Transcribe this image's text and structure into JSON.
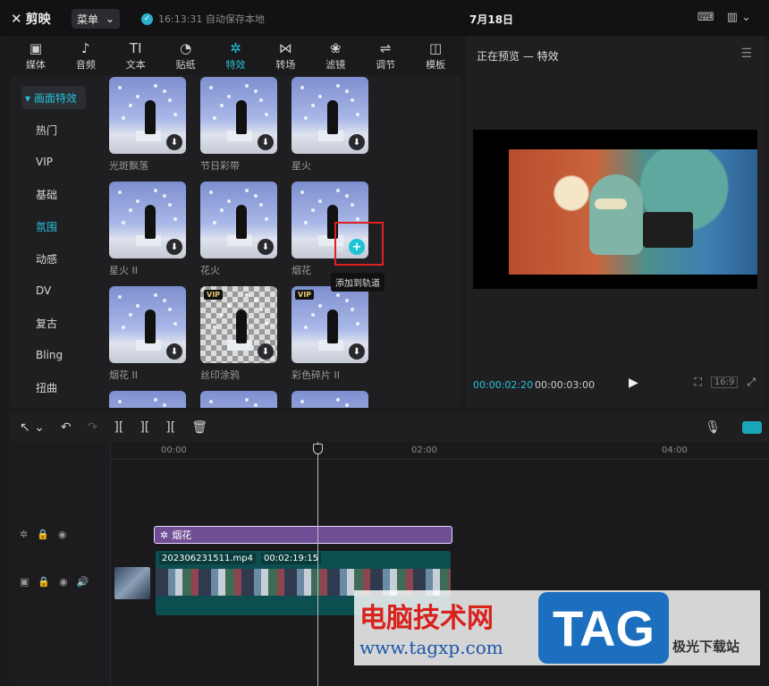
{
  "topbar": {
    "app_name": "剪映",
    "menu_label": "菜单",
    "save_status": "16:13:31 自动保存本地",
    "project_title": "7月18日"
  },
  "categories": [
    {
      "label": "媒体",
      "icon": "▣"
    },
    {
      "label": "音频",
      "icon": "♪"
    },
    {
      "label": "文本",
      "icon": "TI"
    },
    {
      "label": "贴纸",
      "icon": "◔"
    },
    {
      "label": "特效",
      "icon": "✲",
      "active": true
    },
    {
      "label": "转场",
      "icon": "⋈"
    },
    {
      "label": "滤镜",
      "icon": "❀"
    },
    {
      "label": "调节",
      "icon": "⇌"
    },
    {
      "label": "模板",
      "icon": "◫"
    }
  ],
  "subcategories": [
    {
      "label": "▾ 画面特效",
      "active": true
    },
    {
      "label": "热门"
    },
    {
      "label": "VIP"
    },
    {
      "label": "基础"
    },
    {
      "label": "氛围",
      "highlight": true
    },
    {
      "label": "动感"
    },
    {
      "label": "DV"
    },
    {
      "label": "复古"
    },
    {
      "label": "Bling"
    },
    {
      "label": "扭曲"
    }
  ],
  "effects": [
    {
      "label": "光斑飘落"
    },
    {
      "label": "节日彩带"
    },
    {
      "label": "星火"
    },
    {
      "label": "星火 II"
    },
    {
      "label": "花火"
    },
    {
      "label": "烟花",
      "hovered": true
    },
    {
      "label": "烟花 II"
    },
    {
      "label": "丝印涂鸦",
      "vip": "VIP"
    },
    {
      "label": "彩色碎片 II",
      "vip": "VIP"
    }
  ],
  "tooltip": "添加到轨道",
  "preview": {
    "title": "正在预览 — 特效",
    "time_current": "00:00:02:20",
    "time_total": "00:00:03:00",
    "ratio": "16:9"
  },
  "timeline": {
    "ticks": [
      "00:00",
      "02:00",
      "04:00"
    ],
    "effect_clip": "烟花",
    "video_clip_name": "202306231511.mp4",
    "video_clip_duration": "00:02:19:15"
  },
  "watermark": {
    "cn": "电脑技术网",
    "url": "www.tagxp.com",
    "tag": "TAG",
    "site": "极光下载站"
  }
}
